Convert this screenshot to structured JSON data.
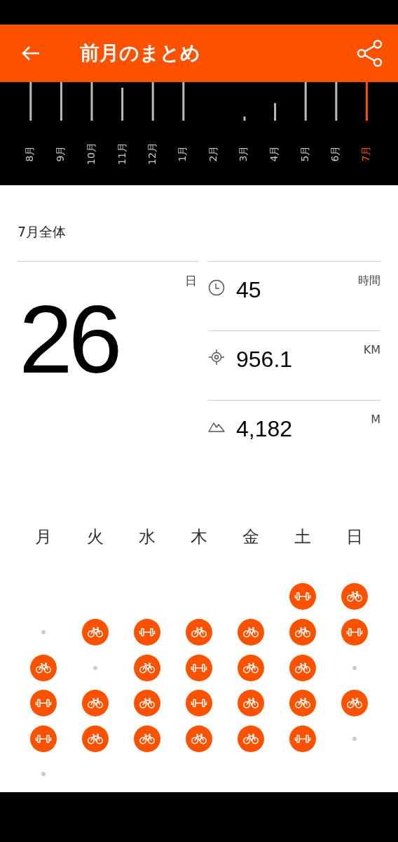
{
  "header": {
    "title": "前月のまとめ"
  },
  "months": [
    {
      "label": "8月",
      "selected": false
    },
    {
      "label": "9月",
      "selected": false
    },
    {
      "label": "10月",
      "selected": false
    },
    {
      "label": "11月",
      "selected": false
    },
    {
      "label": "12月",
      "selected": false
    },
    {
      "label": "1月",
      "selected": false
    },
    {
      "label": "2月",
      "selected": false
    },
    {
      "label": "3月",
      "selected": false
    },
    {
      "label": "4月",
      "selected": false
    },
    {
      "label": "5月",
      "selected": false
    },
    {
      "label": "6月",
      "selected": false
    },
    {
      "label": "7月",
      "selected": true
    }
  ],
  "summary": {
    "title": "7月全体",
    "days": {
      "value": "26",
      "unit": "日"
    },
    "stats": [
      {
        "kind": "time",
        "value": "45",
        "unit": "時間"
      },
      {
        "kind": "distance",
        "value": "956.1",
        "unit": "KM"
      },
      {
        "kind": "elevation",
        "value": "4,182",
        "unit": "M"
      }
    ]
  },
  "weekdays": [
    "月",
    "火",
    "水",
    "木",
    "金",
    "土",
    "日"
  ],
  "weeks": [
    [
      {
        "kind": "workout"
      },
      {
        "kind": "ride"
      }
    ],
    [
      {
        "kind": "rest"
      },
      {
        "kind": "ride"
      },
      {
        "kind": "workout"
      },
      {
        "kind": "ride"
      },
      {
        "kind": "ride"
      },
      {
        "kind": "ride"
      },
      {
        "kind": "workout"
      }
    ],
    [
      {
        "kind": "ride"
      },
      {
        "kind": "rest"
      },
      {
        "kind": "ride"
      },
      {
        "kind": "workout"
      },
      {
        "kind": "ride"
      },
      {
        "kind": "ride"
      },
      {
        "kind": "rest"
      }
    ],
    [
      {
        "kind": "workout"
      },
      {
        "kind": "ride"
      },
      {
        "kind": "ride"
      },
      {
        "kind": "workout"
      },
      {
        "kind": "ride"
      },
      {
        "kind": "ride"
      },
      {
        "kind": "ride"
      }
    ],
    [
      {
        "kind": "workout"
      },
      {
        "kind": "ride"
      },
      {
        "kind": "ride"
      },
      {
        "kind": "ride"
      },
      {
        "kind": "ride"
      },
      {
        "kind": "workout"
      },
      {
        "kind": "rest"
      }
    ],
    [
      {
        "kind": "rest"
      }
    ]
  ]
}
